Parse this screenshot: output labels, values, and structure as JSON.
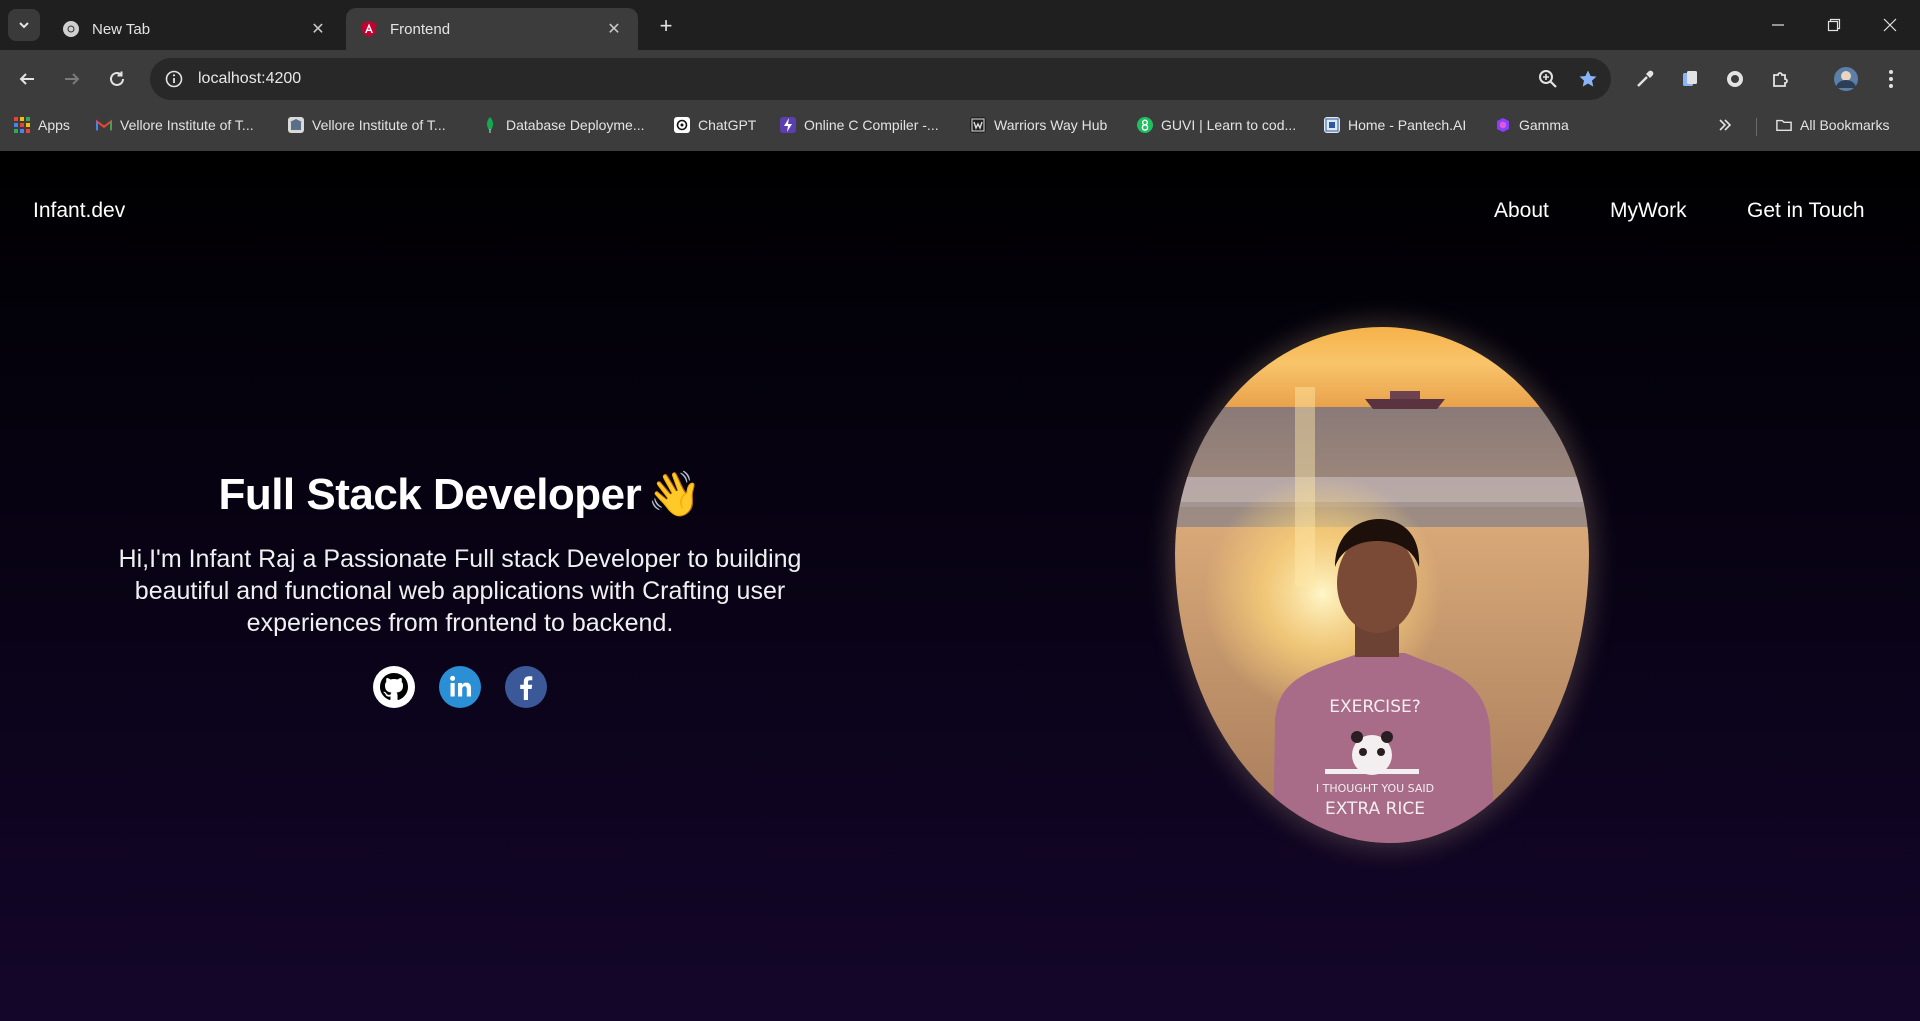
{
  "browser": {
    "tabs": [
      {
        "title": "New Tab",
        "favicon": "chrome-icon"
      },
      {
        "title": "Frontend",
        "favicon": "angular-icon",
        "active": true
      }
    ],
    "address": "localhost:4200",
    "bookmarks": [
      {
        "label": "Apps",
        "icon": "apps-grid-icon"
      },
      {
        "label": "Vellore Institute of T...",
        "icon": "gmail-icon"
      },
      {
        "label": "Vellore Institute of T...",
        "icon": "vit-icon"
      },
      {
        "label": "Database Deployme...",
        "icon": "mongodb-icon"
      },
      {
        "label": "ChatGPT",
        "icon": "chatgpt-icon"
      },
      {
        "label": "Online C Compiler -...",
        "icon": "compiler-icon"
      },
      {
        "label": "Warriors Way Hub",
        "icon": "warriors-icon"
      },
      {
        "label": "GUVI | Learn to cod...",
        "icon": "guvi-icon"
      },
      {
        "label": "Home - Pantech.AI",
        "icon": "pantech-icon"
      },
      {
        "label": "Gamma",
        "icon": "gamma-icon"
      }
    ],
    "all_bookmarks_label": "All Bookmarks"
  },
  "site": {
    "logo": "Infant.dev",
    "nav": [
      "About",
      "MyWork",
      "Get in Touch"
    ],
    "hero": {
      "title": "Full Stack Developer",
      "wave_emoji": "👋",
      "text": "Hi,I'm Infant Raj a Passionate Full stack Developer to building beautiful and functional web applications with Crafting user experiences from frontend to backend."
    },
    "socials": [
      "github-icon",
      "linkedin-icon",
      "facebook-icon"
    ],
    "portrait": {
      "shirt_line1": "EXERCISE?",
      "shirt_line2": "I THOUGHT YOU SAID",
      "shirt_line3": "EXTRA RICE"
    }
  },
  "colors": {
    "accent_star": "#8ab4f8",
    "linkedin": "#2a8fd4",
    "facebook": "#3b5998"
  }
}
